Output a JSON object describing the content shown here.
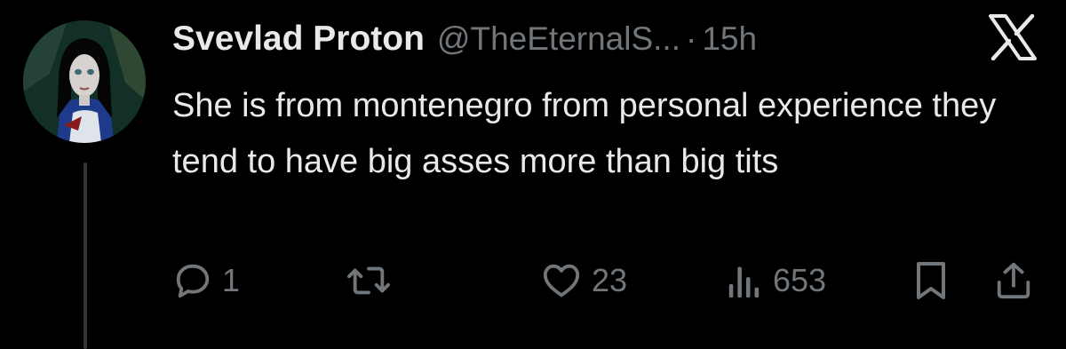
{
  "post": {
    "display_name": "Svevlad Proton",
    "handle": "@TheEternalS...",
    "separator": "·",
    "time": "15h",
    "text": "She is from montenegro from personal experience they tend to have big asses more than big tits"
  },
  "actions": {
    "reply_count": "1",
    "like_count": "23",
    "views_count": "653"
  },
  "icons": {
    "close": "x-logo-icon",
    "reply": "reply-icon",
    "repost": "repost-icon",
    "like": "heart-icon",
    "views": "views-icon",
    "bookmark": "bookmark-icon",
    "share": "share-icon"
  },
  "colors": {
    "background": "#000000",
    "text": "#e7e9ea",
    "muted": "#71767b",
    "thread_line": "#333639"
  }
}
